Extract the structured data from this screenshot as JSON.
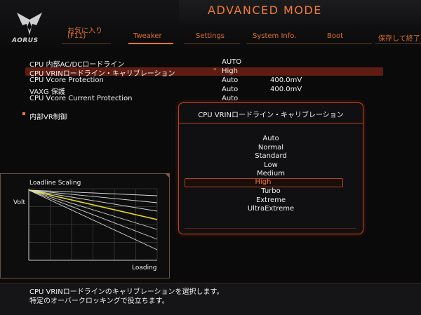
{
  "header": {
    "brand": "AORUS",
    "mode_title": "ADVANCED MODE",
    "favorites_label": "お気に入り",
    "favorites_key": "(F11)",
    "tabs": [
      {
        "label": "Tweaker",
        "active": true
      },
      {
        "label": "Settings",
        "active": false
      },
      {
        "label": "System Info.",
        "active": false
      },
      {
        "label": "Boot",
        "active": false
      },
      {
        "label": "保存して終了",
        "active": false
      }
    ]
  },
  "settings": {
    "items": [
      {
        "label": "CPU 内部AC/DCロードライン",
        "value": "AUTO",
        "extra": ""
      },
      {
        "label": "CPU VRINロードライン・キャリブレーション",
        "value": "High",
        "extra": ""
      },
      {
        "label": "CPU Vcore Protection",
        "value": "Auto",
        "extra": "400.0mV"
      },
      {
        "label": "VAXG 保護",
        "value": "Auto",
        "extra": "400.0mV"
      },
      {
        "label": "CPU Vcore Current Protection",
        "value": "Auto",
        "extra": ""
      }
    ],
    "selected_marker": "*",
    "submenu": "内部VR制御"
  },
  "popup": {
    "title": "CPU VRINロードライン・キャリブレーション",
    "options": [
      "Auto",
      "Normal",
      "Standard",
      "Low",
      "Medium",
      "High",
      "Turbo",
      "Extreme",
      "UltraExtreme"
    ],
    "selected": "High"
  },
  "chart": {
    "title": "Loadline Scaling",
    "ylabel": "Volt",
    "xlabel": "Loading"
  },
  "help": {
    "line1": "CPU VRINロードラインのキャリブレーションを選択します。",
    "line2": "特定のオーバークロッキングで役立ちます。"
  },
  "colors": {
    "accent": "#f07830",
    "highlight_row": "#5e1c12",
    "popup_border": "#c0411c",
    "selected_option": "#f07830",
    "loadline_selected": "#e8e020"
  },
  "chart_data": {
    "type": "line",
    "series": [
      {
        "values": [
          1.0,
          0.92
        ]
      },
      {
        "values": [
          1.0,
          0.82
        ]
      },
      {
        "values": [
          1.0,
          0.7
        ]
      },
      {
        "values": [
          1.0,
          0.58
        ],
        "selected": true
      },
      {
        "values": [
          1.0,
          0.44
        ]
      },
      {
        "values": [
          1.0,
          0.3
        ]
      },
      {
        "values": [
          1.0,
          0.15
        ]
      }
    ],
    "grid": true
  }
}
